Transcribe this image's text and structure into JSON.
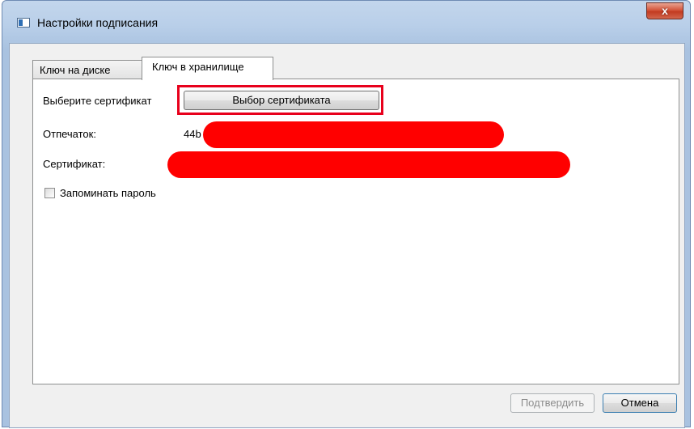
{
  "window": {
    "title": "Настройки подписания",
    "close_label": "x"
  },
  "tabs": [
    {
      "label": "Ключ на диске",
      "active": false
    },
    {
      "label": "Ключ в хранилище",
      "active": true
    }
  ],
  "panel": {
    "select_label": "Выберите сертификат",
    "select_button": "Выбор сертификата",
    "thumbprint_label": "Отпечаток:",
    "thumbprint_value": "44b",
    "certificate_label": "Сертификат:",
    "remember_label": "Запоминать пароль",
    "remember_checked": false
  },
  "footer": {
    "confirm_label": "Подтвердить",
    "confirm_enabled": false,
    "cancel_label": "Отмена"
  },
  "colors": {
    "redaction": "#ff0000",
    "highlight": "#e8001c",
    "titlebar": "#b9cfe9",
    "close_button": "#c23a21"
  },
  "icons": {
    "window_icon": "app-window-icon",
    "close_icon": "close-icon"
  }
}
